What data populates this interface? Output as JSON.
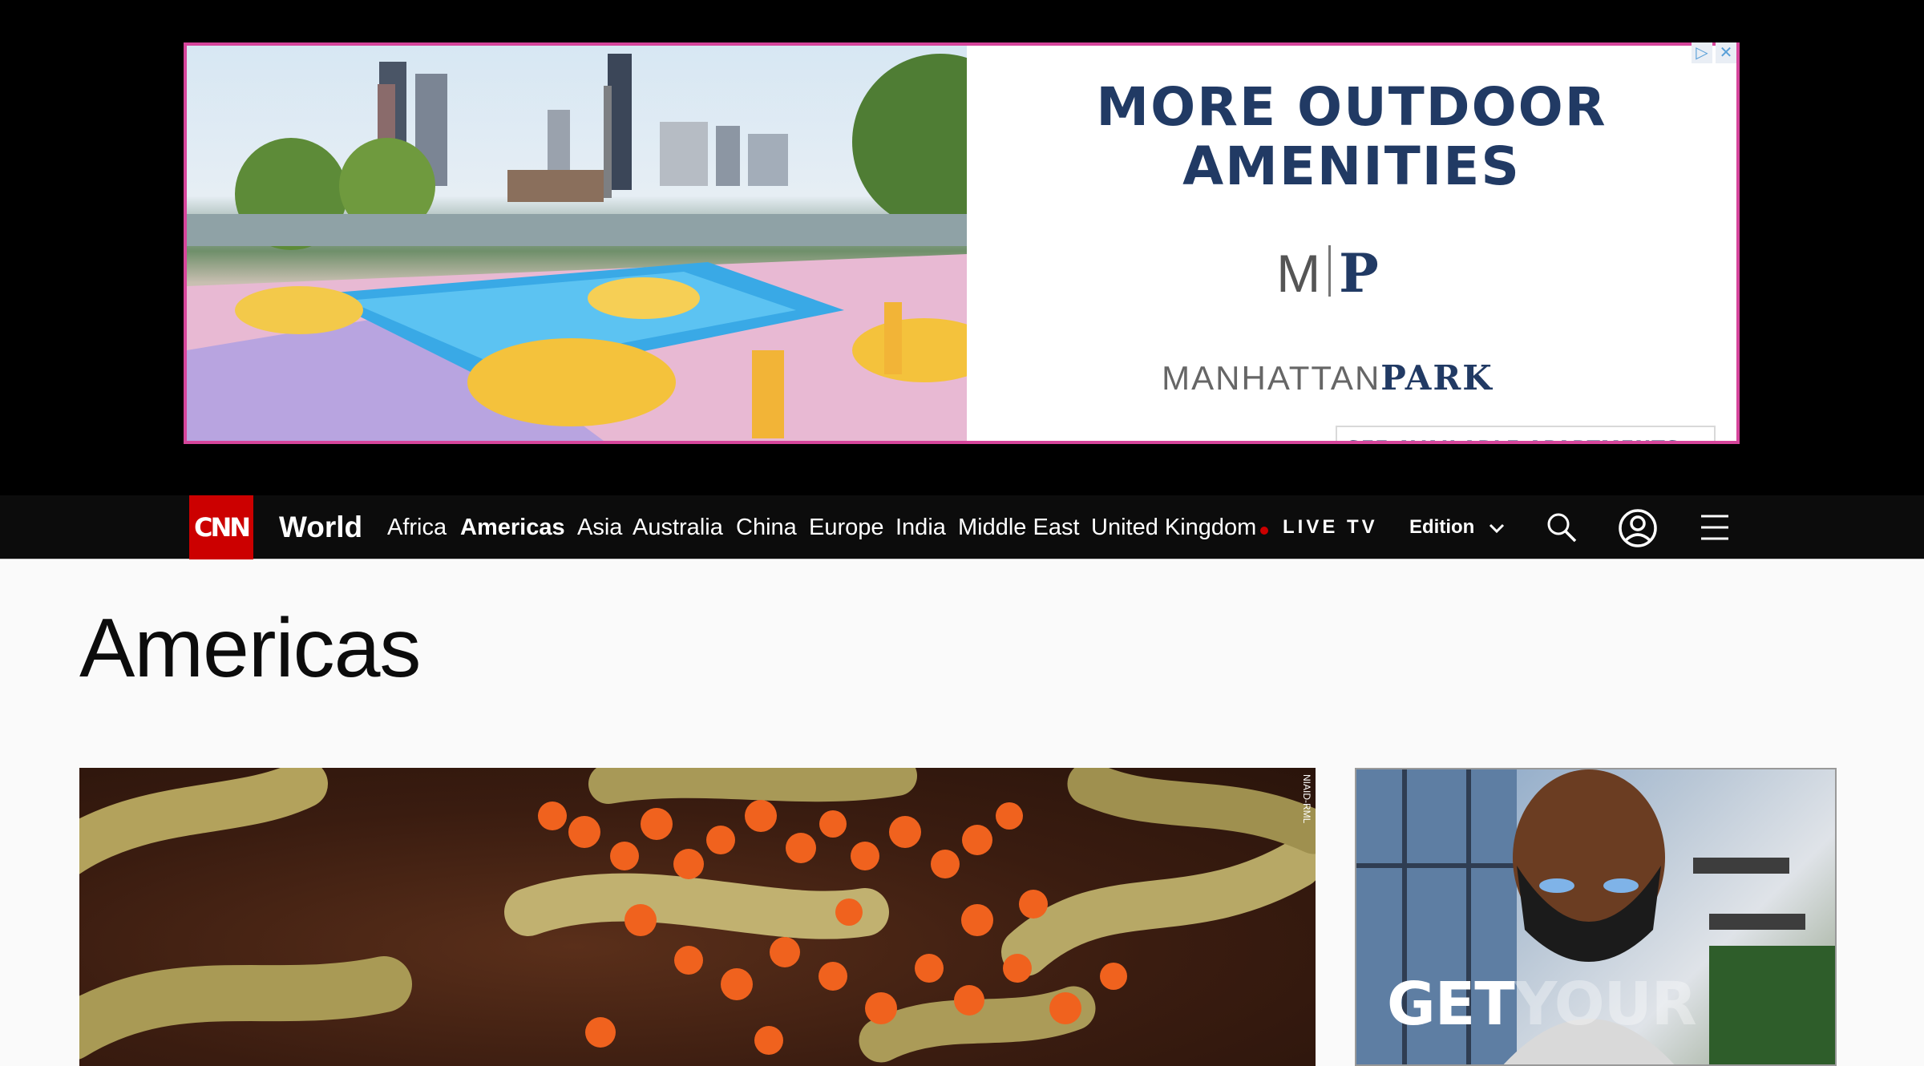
{
  "ad": {
    "headline_line1": "MORE OUTDOOR",
    "headline_line2": "AMENITIES",
    "logo_m": "M",
    "logo_p": "P",
    "brand_light": "MANHATTAN",
    "brand_bold": "PARK",
    "cta": "SEE AVAILABLE APARTMENTS >",
    "choice_icon": "adchoices-icon",
    "close_icon": "close-icon",
    "colors": {
      "border": "#d6459b",
      "text": "#213a64"
    }
  },
  "nav": {
    "logo": "CNN",
    "section": "World",
    "links": [
      "Africa",
      "Americas",
      "Asia",
      "Australia",
      "China",
      "Europe",
      "India",
      "Middle East",
      "United Kingdom"
    ],
    "active": "Americas",
    "live": "LIVE TV",
    "edition": "Edition",
    "colors": {
      "background": "#0c0c0c",
      "logo": "#cc0000"
    }
  },
  "page": {
    "title": "Americas"
  },
  "hero": {
    "credit": "NIAID-RML"
  },
  "side_ad": {
    "headline_visible": "GET",
    "headline_faded": "YOUR"
  }
}
